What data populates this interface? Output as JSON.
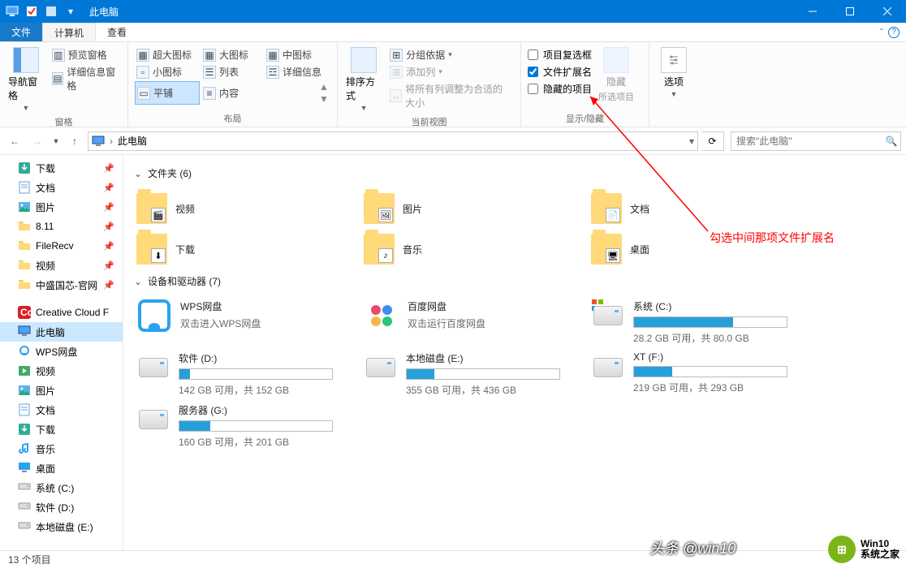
{
  "window": {
    "title": "此电脑"
  },
  "tabs": {
    "file": "文件",
    "computer": "计算机",
    "view": "查看"
  },
  "ribbon": {
    "panes": {
      "g1": {
        "nav": "导航窗格",
        "preview": "预览窗格",
        "details": "详细信息窗格",
        "caption": "窗格"
      },
      "g2": {
        "xl": "超大图标",
        "lg": "大图标",
        "md": "中图标",
        "sm": "小图标",
        "list": "列表",
        "det": "详细信息",
        "tile": "平铺",
        "content": "内容",
        "caption": "布局"
      },
      "g3": {
        "sort": "排序方式",
        "group": "分组依据",
        "addcol": "添加列",
        "fit": "将所有列调整为合适的大小",
        "caption": "当前视图"
      },
      "g4": {
        "chk1": "项目复选框",
        "chk2": "文件扩展名",
        "chk3": "隐藏的项目",
        "hide": "隐藏",
        "hide2": "所选项目",
        "caption": "显示/隐藏"
      },
      "g5": {
        "opt": "选项"
      }
    }
  },
  "address": {
    "location": "此电脑",
    "search_ph": "搜索\"此电脑\""
  },
  "nav": {
    "items": [
      {
        "label": "下载",
        "icon": "download",
        "pin": true
      },
      {
        "label": "文档",
        "icon": "doc",
        "pin": true
      },
      {
        "label": "图片",
        "icon": "pic",
        "pin": true
      },
      {
        "label": "8.11",
        "icon": "folder",
        "pin": true
      },
      {
        "label": "FileRecv",
        "icon": "folder",
        "pin": true
      },
      {
        "label": "视频",
        "icon": "folder",
        "pin": true
      },
      {
        "label": "中盛国芯-官网",
        "icon": "folder",
        "pin": true
      },
      {
        "label": "Creative Cloud F",
        "icon": "cc",
        "pin": false
      },
      {
        "label": "此电脑",
        "icon": "pc",
        "pin": false,
        "selected": true
      },
      {
        "label": "WPS网盘",
        "icon": "wps",
        "pin": false
      },
      {
        "label": "视频",
        "icon": "video",
        "pin": false
      },
      {
        "label": "图片",
        "icon": "pic",
        "pin": false
      },
      {
        "label": "文档",
        "icon": "doc",
        "pin": false
      },
      {
        "label": "下载",
        "icon": "download",
        "pin": false
      },
      {
        "label": "音乐",
        "icon": "music",
        "pin": false
      },
      {
        "label": "桌面",
        "icon": "desktop",
        "pin": false
      },
      {
        "label": "系统 (C:)",
        "icon": "drive",
        "pin": false
      },
      {
        "label": "软件 (D:)",
        "icon": "drive",
        "pin": false
      },
      {
        "label": "本地磁盘 (E:)",
        "icon": "drive",
        "pin": false
      }
    ]
  },
  "content": {
    "folders_header": "文件夹 (6)",
    "folders": [
      {
        "label": "视频"
      },
      {
        "label": "图片"
      },
      {
        "label": "文档"
      },
      {
        "label": "下载"
      },
      {
        "label": "音乐"
      },
      {
        "label": "桌面"
      }
    ],
    "drives_header": "设备和驱动器 (7)",
    "special": [
      {
        "title": "WPS网盘",
        "sub": "双击进入WPS网盘",
        "kind": "wps"
      },
      {
        "title": "百度网盘",
        "sub": "双击运行百度网盘",
        "kind": "baidu"
      }
    ],
    "drives": [
      {
        "title": "系统 (C:)",
        "sub": "28.2 GB 可用，共 80.0 GB",
        "pct": 65,
        "os": true
      },
      {
        "title": "软件 (D:)",
        "sub": "142 GB 可用，共 152 GB",
        "pct": 7
      },
      {
        "title": "本地磁盘 (E:)",
        "sub": "355 GB 可用，共 436 GB",
        "pct": 18
      },
      {
        "title": "XT (F:)",
        "sub": "219 GB 可用，共 293 GB",
        "pct": 25
      },
      {
        "title": "服务器 (G:)",
        "sub": "160 GB 可用，共 201 GB",
        "pct": 20
      }
    ]
  },
  "status": {
    "count": "13 个项目"
  },
  "annotation": {
    "text": "勾选中间那项文件扩展名"
  },
  "watermark": {
    "w1": "头条 @win10",
    "w2a": "Win10",
    "w2b": "系统之家"
  }
}
